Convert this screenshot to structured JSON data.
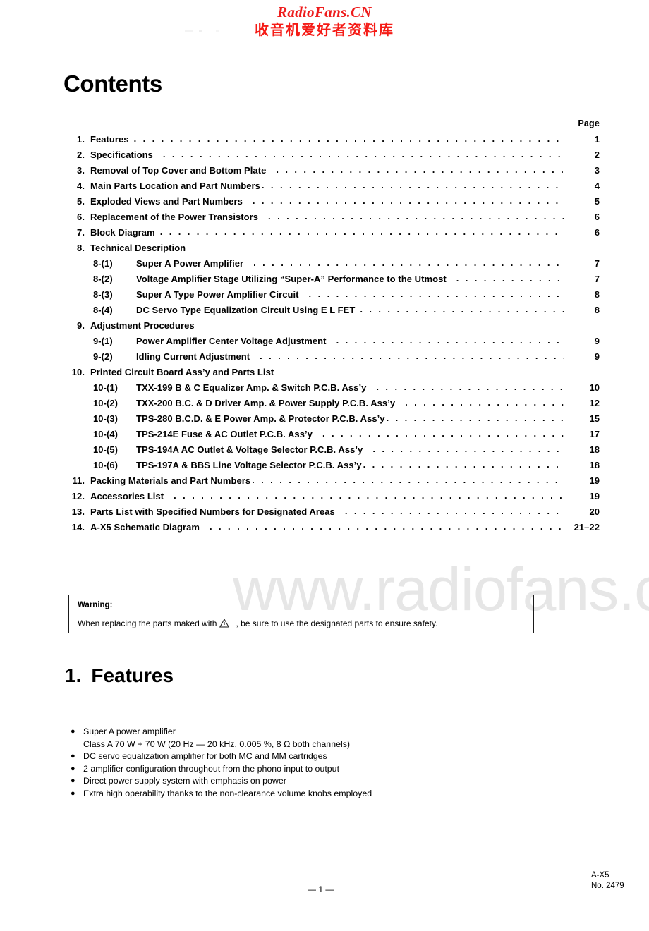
{
  "watermark": {
    "header_latin": "RadioFans.CN",
    "header_cjk": "收音机爱好者资料库",
    "body_text": "www.radiofans.c"
  },
  "contents": {
    "title": "Contents",
    "page_column_header": "Page",
    "entries": [
      {
        "num": "1.",
        "label": "Features",
        "page": "1",
        "level": 1,
        "leader": "normal"
      },
      {
        "num": "2.",
        "label": "Specifications",
        "page": "2",
        "level": 1,
        "leader": "wide"
      },
      {
        "num": "3.",
        "label": "Removal of Top Cover and Bottom Plate",
        "page": "3",
        "level": 1,
        "leader": "wide"
      },
      {
        "num": "4.",
        "label": "Main Parts Location and Part Numbers",
        "page": "4",
        "level": 1,
        "leader": "none"
      },
      {
        "num": "5.",
        "label": "Exploded Views and Part Numbers",
        "page": "5",
        "level": 1,
        "leader": "wide"
      },
      {
        "num": "6.",
        "label": "Replacement of the Power Transistors",
        "page": "6",
        "level": 1,
        "leader": "wide"
      },
      {
        "num": "7.",
        "label": "Block Diagram",
        "page": "6",
        "level": 1,
        "leader": "normal"
      },
      {
        "num": "8.",
        "label": "Technical Description",
        "page": "",
        "level": 1,
        "leader": "hidden"
      },
      {
        "num": "8-(1)",
        "label": "Super A Power Amplifier",
        "page": "7",
        "level": 2,
        "leader": "wide"
      },
      {
        "num": "8-(2)",
        "label": "Voltage Amplifier Stage Utilizing “Super-A” Performance to the Utmost",
        "page": "7",
        "level": 2,
        "leader": "wide"
      },
      {
        "num": "8-(3)",
        "label": "Super A Type Power Amplifier Circuit",
        "page": "8",
        "level": 2,
        "leader": "wide"
      },
      {
        "num": "8-(4)",
        "label": "DC Servo Type Equalization Circuit Using E L FET",
        "page": "8",
        "level": 2,
        "leader": "normal"
      },
      {
        "num": "9.",
        "label": "Adjustment Procedures",
        "page": "",
        "level": 1,
        "leader": "hidden"
      },
      {
        "num": "9-(1)",
        "label": "Power Amplifier Center Voltage Adjustment",
        "page": "9",
        "level": 2,
        "leader": "wide"
      },
      {
        "num": "9-(2)",
        "label": "Idling Current Adjustment",
        "page": "9",
        "level": 2,
        "leader": "wide"
      },
      {
        "num": "10.",
        "label": "Printed Circuit Board Ass’y and Parts List",
        "page": "",
        "level": 1,
        "leader": "hidden"
      },
      {
        "num": "10-(1)",
        "label": "TXX-199 B & C Equalizer Amp. & Switch P.C.B. Ass’y",
        "page": "10",
        "level": 2,
        "leader": "wide"
      },
      {
        "num": "10-(2)",
        "label": "TXX-200 B.C. & D Driver Amp. & Power Supply P.C.B. Ass’y",
        "page": "12",
        "level": 2,
        "leader": "wide"
      },
      {
        "num": "10-(3)",
        "label": "TPS-280 B.C.D. & E Power Amp. & Protector P.C.B. Ass’y",
        "page": "15",
        "level": 2,
        "leader": "none"
      },
      {
        "num": "10-(4)",
        "label": "TPS-214E Fuse & AC Outlet P.C.B. Ass’y",
        "page": "17",
        "level": 2,
        "leader": "wide"
      },
      {
        "num": "10-(5)",
        "label": "TPS-194A AC Outlet & Voltage Selector P.C.B. Ass’y",
        "page": "18",
        "level": 2,
        "leader": "wide"
      },
      {
        "num": "10-(6)",
        "label": "TPS-197A & BBS Line Voltage Selector P.C.B. Ass’y",
        "page": "18",
        "level": 2,
        "leader": "none"
      },
      {
        "num": "11.",
        "label": "Packing Materials and Part Numbers",
        "page": "19",
        "level": 1,
        "leader": "none"
      },
      {
        "num": "12.",
        "label": "Accessories List",
        "page": "19",
        "level": 1,
        "leader": "wide"
      },
      {
        "num": "13.",
        "label": "Parts List with Specified Numbers for Designated Areas",
        "page": "20",
        "level": 1,
        "leader": "wide"
      },
      {
        "num": "14.",
        "label": "A-X5 Schematic Diagram",
        "page": "21–22",
        "level": 1,
        "leader": "wide"
      }
    ]
  },
  "warning": {
    "title": "Warning:",
    "text_before_icon": "When replacing the parts maked with",
    "icon": "warning-triangle-icon",
    "text_after_icon": ", be sure to use the designated parts to ensure safety."
  },
  "features_section": {
    "number": "1.",
    "heading": "Features",
    "items": [
      {
        "text": "Super A power amplifier",
        "subtext": "Class A 70 W + 70 W (20 Hz — 20 kHz, 0.005 %, 8 Ω both channels)"
      },
      {
        "text": "DC servo equalization amplifier for both MC and MM cartridges",
        "subtext": ""
      },
      {
        "text": "2 amplifier configuration throughout from the phono input to output",
        "subtext": ""
      },
      {
        "text": "Direct power supply system with emphasis on power",
        "subtext": ""
      },
      {
        "text": "Extra high operability thanks to the non-clearance volume knobs employed",
        "subtext": ""
      }
    ],
    "bullet_glyph": "●"
  },
  "footer": {
    "page_number": "— 1 —",
    "model": "A-X5",
    "doc_number": "No. 2479"
  },
  "leader_dots": ". . . . . . . . . . . . . . . . . . . . . . . . . . . . . . . . . . . . . . . . . . . . . . . . . . . . . . . . . . . . . . . . . . . . . . . . . . . . . . . . . . . . . . . . . . . . . . . . . . ."
}
